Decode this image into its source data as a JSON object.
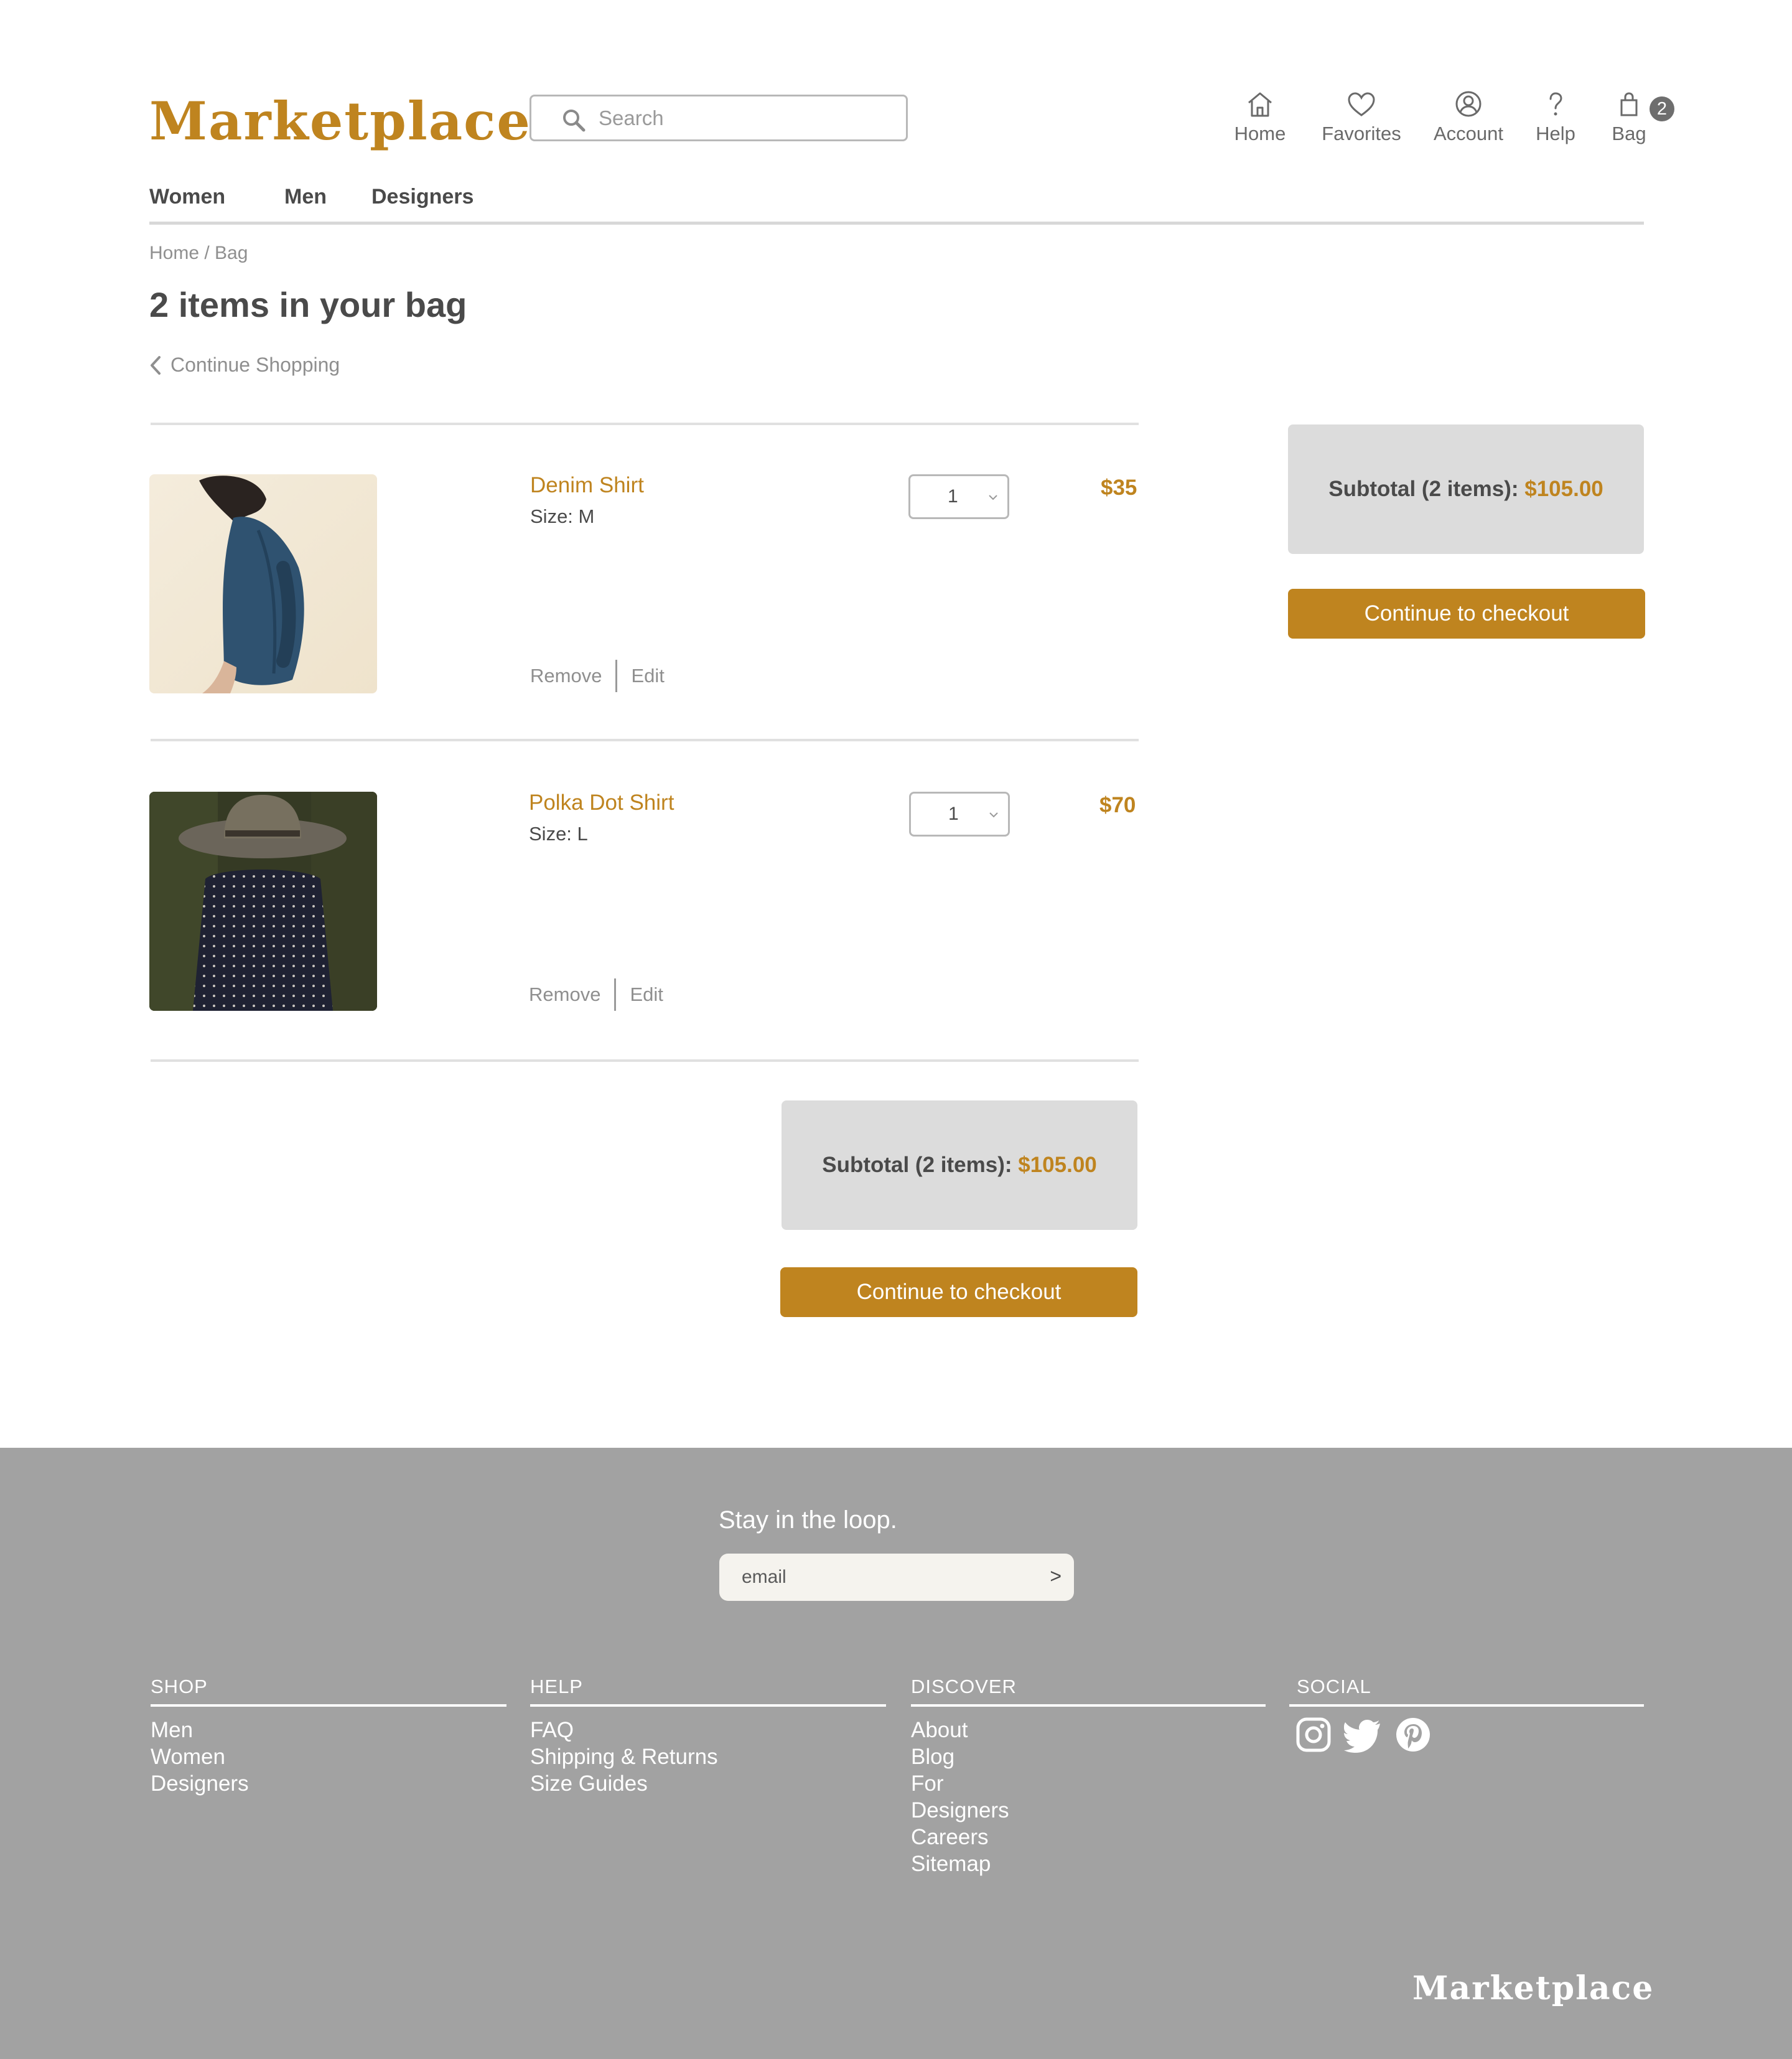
{
  "header": {
    "logo": "Marketplace",
    "search_placeholder": "Search",
    "nav": {
      "home": "Home",
      "favorites": "Favorites",
      "account": "Account",
      "help": "Help",
      "bag": "Bag",
      "bag_count": "2"
    },
    "categories": [
      "Women",
      "Men",
      "Designers"
    ]
  },
  "breadcrumb": "Home / Bag",
  "page_title": "2 items in your bag",
  "continue_shopping": "Continue Shopping",
  "items": [
    {
      "name": "Denim Shirt",
      "size": "Size: M",
      "qty": "1",
      "price": "$35",
      "remove": "Remove",
      "edit": "Edit"
    },
    {
      "name": "Polka Dot Shirt",
      "size": "Size: L",
      "qty": "1",
      "price": "$70",
      "remove": "Remove",
      "edit": "Edit"
    }
  ],
  "summary": {
    "label": "Subtotal (2 items):",
    "amount": "$105.00",
    "checkout": "Continue to checkout"
  },
  "footer": {
    "newsletter_title": "Stay in the loop.",
    "email_placeholder": "email",
    "email_submit": ">",
    "columns": {
      "shop": {
        "title": "SHOP",
        "links": [
          "Men",
          "Women",
          "Designers"
        ]
      },
      "help": {
        "title": "HELP",
        "links": [
          "FAQ",
          "Shipping & Returns",
          "Size Guides"
        ]
      },
      "discover": {
        "title": "DISCOVER",
        "links": [
          "About",
          "Blog",
          "For",
          "Designers",
          "Careers",
          "Sitemap"
        ]
      },
      "social": {
        "title": "SOCIAL",
        "icons": [
          "instagram-icon",
          "twitter-icon",
          "pinterest-icon"
        ]
      }
    },
    "logo": "Marketplace"
  },
  "colors": {
    "accent": "#bf841f",
    "footer_bg": "#a2a2a2",
    "summary_bg": "#dcdcdc"
  }
}
